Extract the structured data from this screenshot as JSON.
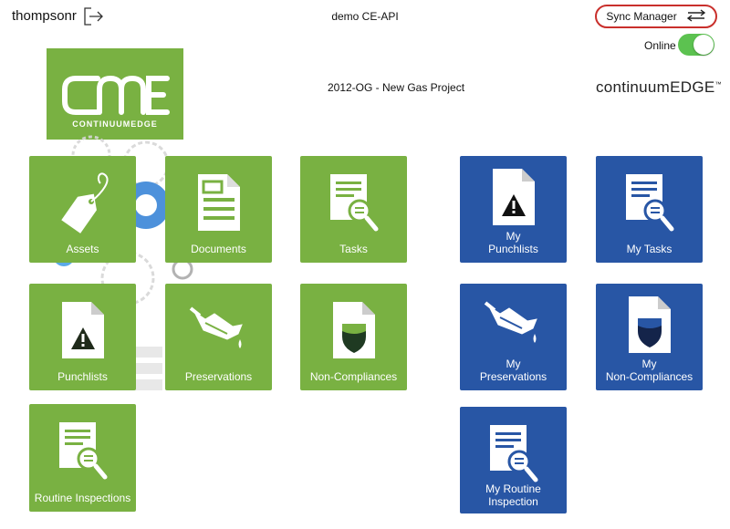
{
  "header": {
    "username": "thompsonr",
    "environment": "demo  CE-API",
    "sync_manager_label": "Sync Manager",
    "online_label": "Online",
    "online": true
  },
  "project": {
    "title": "2012-OG - New Gas Project",
    "logo_text": "CME",
    "logo_subtext": "CONTINUUMEDGE",
    "brand_text": "continuumEDGE",
    "brand_tm": "™"
  },
  "colors": {
    "green": "#79b142",
    "blue": "#2856a5",
    "toggle_on": "#5cc250",
    "sync_outline": "#c9302c"
  },
  "tiles": {
    "assets": {
      "label": "Assets",
      "icon": "tag-icon"
    },
    "documents": {
      "label": "Documents",
      "icon": "document-icon"
    },
    "tasks": {
      "label": "Tasks",
      "icon": "task-search-icon"
    },
    "punchlists": {
      "label": "Punchlists",
      "icon": "warning-document-icon"
    },
    "preservations": {
      "label": "Preservations",
      "icon": "oil-can-icon"
    },
    "non_compliances": {
      "label": "Non-Compliances",
      "icon": "shield-document-icon"
    },
    "routine_inspections": {
      "label": "Routine Inspections",
      "icon": "task-search-icon"
    },
    "my_punchlists": {
      "label_line1": "My",
      "label_line2": "Punchlists",
      "icon": "warning-document-icon"
    },
    "my_tasks": {
      "label": "My Tasks",
      "icon": "task-search-icon"
    },
    "my_preservations": {
      "label_line1": "My",
      "label_line2": "Preservations",
      "icon": "oil-can-icon"
    },
    "my_non_compliances": {
      "label_line1": "My",
      "label_line2": "Non-Compliances",
      "icon": "shield-document-icon"
    },
    "my_routine_inspection": {
      "label": "My Routine Inspection",
      "icon": "task-search-icon"
    }
  }
}
